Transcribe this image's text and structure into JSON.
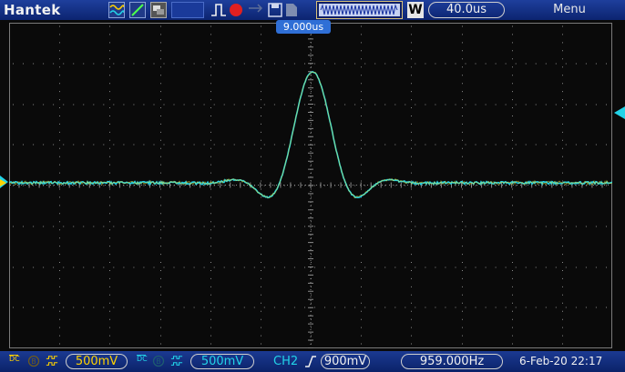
{
  "topbar": {
    "brand": "Hantek",
    "timebase": "40.0us",
    "window_mode": "W",
    "menu": "Menu",
    "usb_icon": "usb-icon"
  },
  "screen": {
    "trigger_position": "9.000us",
    "grid": {
      "h_divs": 12,
      "v_divs": 8
    },
    "waveform_color": "#22d3e8",
    "background": "#0a0a0a"
  },
  "bottombar": {
    "ch1_coupling": "DC",
    "ch1_volts": "500mV",
    "ch2_coupling": "DC",
    "ch2_volts": "500mV",
    "trigger_source": "CH2",
    "trigger_level": "900mV",
    "frequency": "959.000Hz",
    "datetime": "6-Feb-20 22:17"
  },
  "colors": {
    "ch1": "#ffd200",
    "ch2": "#22d3e8",
    "bar": "#1b3a92",
    "run_indicator": "#e02020"
  }
}
